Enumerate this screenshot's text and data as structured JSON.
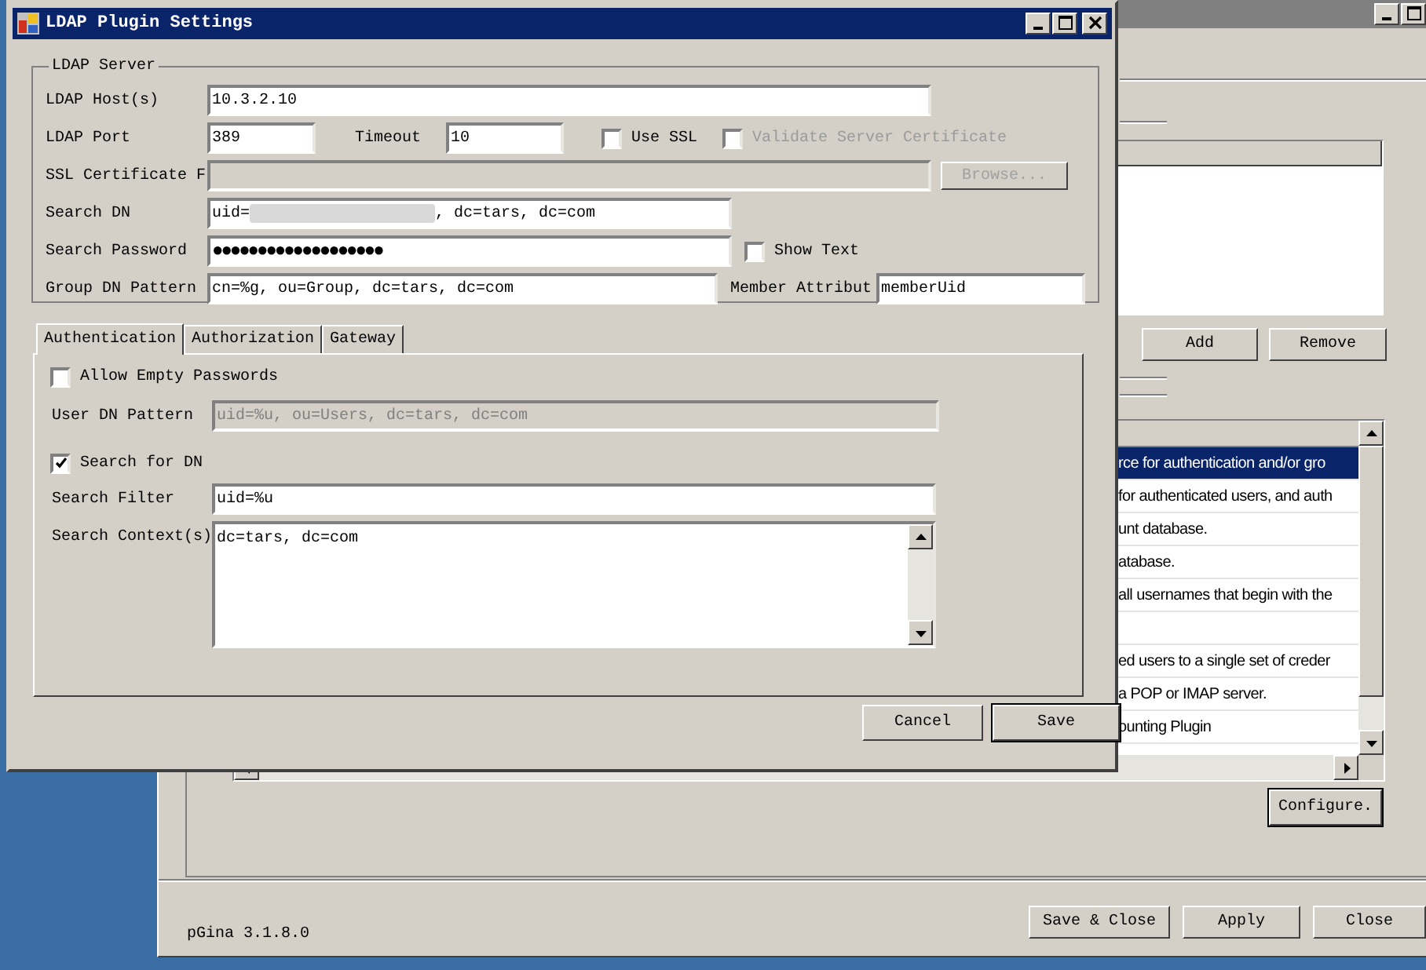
{
  "background_window": {
    "plugin_list": {
      "rows": [
        {
          "text": "rce for authentication and/or gro",
          "selected": true
        },
        {
          "text": "for authenticated users, and auth",
          "selected": false
        },
        {
          "text": "unt database.",
          "selected": false
        },
        {
          "text": "atabase.",
          "selected": false
        },
        {
          "text": "all usernames that begin with the",
          "selected": false
        },
        {
          "text": "",
          "selected": false
        },
        {
          "text": "ed users to a single set of creder",
          "selected": false
        },
        {
          "text": " a POP or IMAP server.",
          "selected": false
        },
        {
          "text": "ounting Plugin",
          "selected": false
        }
      ]
    },
    "list_buttons": [
      "Add",
      "Remove"
    ],
    "configure_button": "Configure.",
    "version": "pGina 3.1.8.0",
    "footer_buttons": [
      "Save & Close",
      "Apply",
      "Close"
    ]
  },
  "dialog": {
    "title": "LDAP Plugin Settings",
    "ldap_server": {
      "legend": "LDAP Server",
      "host": {
        "label": "LDAP Host(s)",
        "value": "10.3.2.10"
      },
      "port": {
        "label": "LDAP Port",
        "value": "389"
      },
      "timeout": {
        "label": "Timeout",
        "value": "10"
      },
      "use_ssl": {
        "label": "Use SSL",
        "checked": false
      },
      "validate_cert": {
        "label": "Validate Server Certificate",
        "checked": false,
        "disabled": true
      },
      "ssl_cert": {
        "label": "SSL Certificate F",
        "disabled": true
      },
      "browse_button": {
        "label": "Browse...",
        "disabled": true
      },
      "search_dn": {
        "label": "Search DN",
        "value_start": "uid=",
        "value_end": ", dc=tars, dc=com"
      },
      "search_password": {
        "label": "Search Password",
        "value": "●●●●●●●●●●●●●●●●●●●"
      },
      "show_text": {
        "label": "Show Text",
        "checked": false
      },
      "group_dn_pattern": {
        "label": "Group DN Pattern",
        "value": "cn=%g, ou=Group, dc=tars, dc=com"
      },
      "member_attribute": {
        "label": "Member Attribut",
        "value": "memberUid"
      }
    },
    "tabs": [
      {
        "label": "Authentication",
        "selected": true
      },
      {
        "label": "Authorization",
        "selected": false
      },
      {
        "label": "Gateway",
        "selected": false
      }
    ],
    "authentication": {
      "allow_empty_passwords": {
        "label": "Allow Empty Passwords",
        "checked": false
      },
      "user_dn_pattern": {
        "label": "User DN Pattern",
        "value": "uid=%u, ou=Users, dc=tars, dc=com",
        "disabled": true
      },
      "search_for_dn": {
        "label": "Search for DN",
        "checked": true
      },
      "search_filter": {
        "label": "Search Filter",
        "value": "uid=%u"
      },
      "search_context": {
        "label": "Search Context(s)",
        "value": "dc=tars, dc=com"
      }
    },
    "buttons": [
      "Cancel",
      "Save"
    ]
  }
}
